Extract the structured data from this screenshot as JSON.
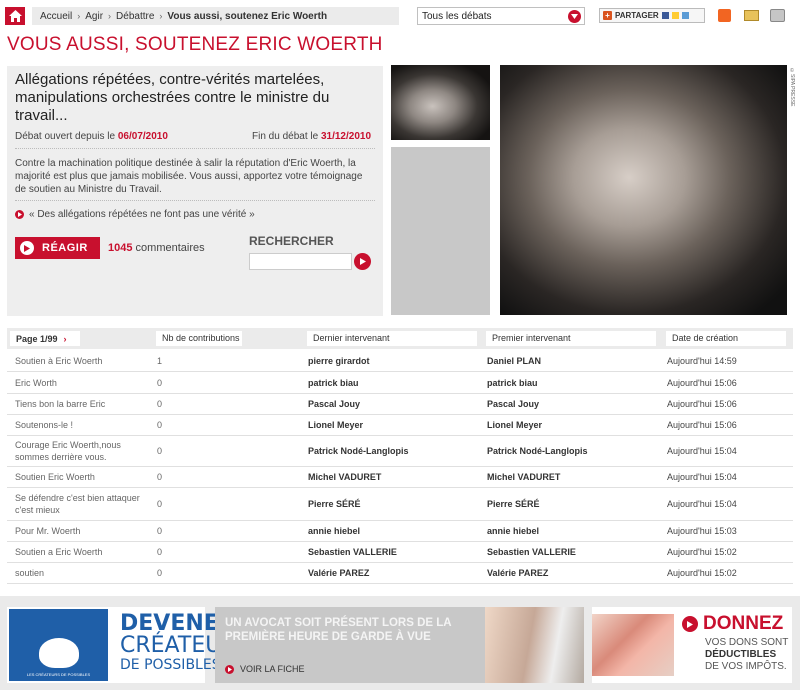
{
  "breadcrumb": {
    "items": [
      "Accueil",
      "Agir",
      "Débattre"
    ],
    "current": "Vous aussi, soutenez Eric Woerth"
  },
  "debate_select": {
    "value": "Tous les débats"
  },
  "share": {
    "label": "PARTAGER"
  },
  "page_title": "VOUS AUSSI, SOUTENEZ ERIC WOERTH",
  "debate": {
    "subject": "Allégations répétées, contre-vérités martelées, manipulations orchestrées contre le ministre du travail...",
    "opened_label": "Débat ouvert depuis le",
    "opened_date": "06/07/2010",
    "end_label": "Fin du débat le",
    "end_date": "31/12/2010",
    "description": "Contre la machination politique destinée à salir la réputation d'Eric Woerth, la majorité est plus que jamais mobilisée. Vous aussi, apportez votre témoignage de soutien au Ministre du Travail.",
    "quote": "« Des allégations répétées ne font pas une vérité »",
    "react_label": "RÉAGIR",
    "comments_count": "1045",
    "comments_label": "commentaires",
    "search_heading": "RECHERCHER",
    "search_value": ""
  },
  "photo_credit": "©SIPA PRESSE",
  "table": {
    "page_label": "Page 1/99",
    "headers": [
      "Nb de contributions",
      "Dernier intervenant",
      "Premier intervenant",
      "Date de création"
    ],
    "rows": [
      {
        "topic": "Soutien à Eric Woerth",
        "count": "1",
        "last": "pierre girardot",
        "first": "Daniel PLAN",
        "date": "Aujourd'hui 14:59"
      },
      {
        "topic": "Eric Worth",
        "count": "0",
        "last": "patrick biau",
        "first": "patrick biau",
        "date": "Aujourd'hui 15:06"
      },
      {
        "topic": "Tiens bon la barre Eric",
        "count": "0",
        "last": "Pascal Jouy",
        "first": "Pascal Jouy",
        "date": "Aujourd'hui 15:06"
      },
      {
        "topic": "Soutenons-le !",
        "count": "0",
        "last": "Lionel Meyer",
        "first": "Lionel Meyer",
        "date": "Aujourd'hui 15:06"
      },
      {
        "topic": "Courage Eric Woerth,nous sommes derrière vous.",
        "count": "0",
        "last": "Patrick Nodé-Langlopis",
        "first": "Patrick Nodé-Langlopis",
        "date": "Aujourd'hui 15:04"
      },
      {
        "topic": "Soutien Eric Woerth",
        "count": "0",
        "last": "Michel VADURET",
        "first": "Michel VADURET",
        "date": "Aujourd'hui 15:04"
      },
      {
        "topic": "Se défendre c'est bien attaquer c'est mieux",
        "count": "0",
        "last": "Pierre SÉRÉ",
        "first": "Pierre SÉRÉ",
        "date": "Aujourd'hui 15:04"
      },
      {
        "topic": "Pour Mr. Woerth",
        "count": "0",
        "last": "annie hiebel",
        "first": "annie hiebel",
        "date": "Aujourd'hui 15:03"
      },
      {
        "topic": "Soutien a Eric Woerth",
        "count": "0",
        "last": "Sebastien VALLERIE",
        "first": "Sebastien VALLERIE",
        "date": "Aujourd'hui 15:02"
      },
      {
        "topic": "soutien",
        "count": "0",
        "last": "Valérie PAREZ",
        "first": "Valérie PAREZ",
        "date": "Aujourd'hui 15:02"
      }
    ]
  },
  "banners": {
    "b1": {
      "logo_text": "LES CRÉATEURS DE POSSIBLES",
      "line1": "DEVENEZ",
      "line2": "CRÉATEUR",
      "line3": "DE POSSIBLES"
    },
    "b2": {
      "text": "UN AVOCAT SOIT PRÉSENT LORS DE LA PREMIÈRE HEURE DE GARDE À VUE",
      "link": "VOIR LA FICHE"
    },
    "b3": {
      "title": "DONNEZ",
      "line1": "VOS DONS SONT",
      "line2": "DÉDUCTIBLES",
      "line3": "DE VOS IMPÔTS."
    }
  },
  "colors": {
    "accent": "#c8102e",
    "banner_blue": "#1f5fa8"
  }
}
